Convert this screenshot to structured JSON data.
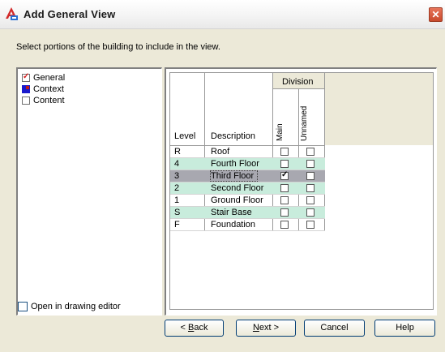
{
  "window": {
    "title": "Add General View",
    "close_glyph": "✕",
    "app_icon": "autocad-a-icon"
  },
  "prompt": "Select portions of the building to include in the view.",
  "left_list": {
    "items": [
      {
        "label": "General",
        "state": "checked"
      },
      {
        "label": "Context",
        "state": "blue-fill"
      },
      {
        "label": "Content",
        "state": "unchecked"
      }
    ]
  },
  "grid": {
    "group_header": "Division",
    "columns": {
      "level": "Level",
      "description": "Description",
      "main": "Main",
      "unnamed": "Unnamed"
    },
    "rows": [
      {
        "level": "R",
        "description": "Roof",
        "main": false,
        "unnamed": false,
        "style": "white"
      },
      {
        "level": "4",
        "description": "Fourth Floor",
        "main": false,
        "unnamed": false,
        "style": "teal"
      },
      {
        "level": "3",
        "description": "Third Floor",
        "main": true,
        "unnamed": false,
        "style": "selected"
      },
      {
        "level": "2",
        "description": "Second Floor",
        "main": false,
        "unnamed": false,
        "style": "teal"
      },
      {
        "level": "1",
        "description": "Ground Floor",
        "main": false,
        "unnamed": false,
        "style": "white"
      },
      {
        "level": "S",
        "description": "Stair Base",
        "main": false,
        "unnamed": false,
        "style": "teal"
      },
      {
        "level": "F",
        "description": "Foundation",
        "main": false,
        "unnamed": false,
        "style": "white"
      }
    ]
  },
  "open_in_editor": {
    "label": "Open in drawing editor",
    "checked": false
  },
  "buttons": {
    "back": {
      "prefix": "< ",
      "mnemonic": "B",
      "rest": "ack"
    },
    "next": {
      "mnemonic": "N",
      "rest": "ext >"
    },
    "cancel": "Cancel",
    "help": "Help"
  },
  "colors": {
    "teal_row": "#c8ecdc",
    "selected_row": "#a8a8b0",
    "dialog_bg": "#ece9d8",
    "close_red": "#d0502f"
  }
}
